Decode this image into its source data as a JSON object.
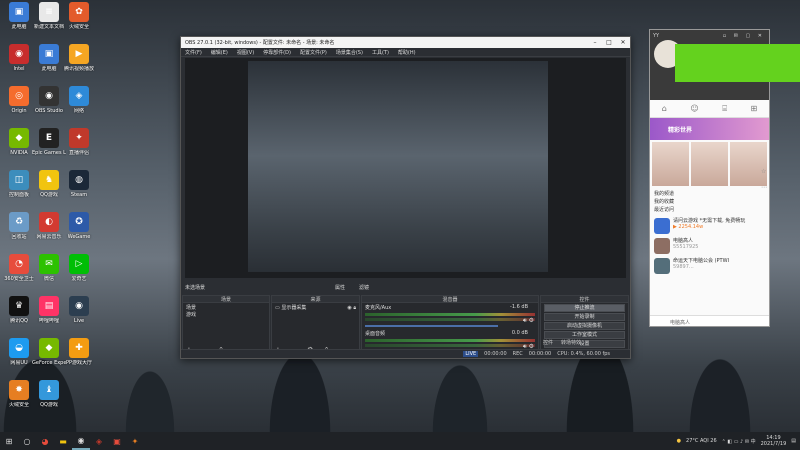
{
  "desktop": {
    "icons": [
      {
        "label": "此电脑",
        "glyph": "▣",
        "color": "#3a7bd5"
      },
      {
        "label": "新建文本文档",
        "glyph": "≡",
        "color": "#e8e8e8"
      },
      {
        "label": "火绒安全",
        "glyph": "✿",
        "color": "#e35b2b"
      },
      {
        "label": "Intel",
        "glyph": "◉",
        "color": "#c72d2d"
      },
      {
        "label": "此电脑",
        "glyph": "▣",
        "color": "#3a7bd5"
      },
      {
        "label": "腾讯视频播放",
        "glyph": "▶",
        "color": "#f5a623"
      },
      {
        "label": "Origin",
        "glyph": "◎",
        "color": "#f56c2d"
      },
      {
        "label": "OBS Studio",
        "glyph": "◉",
        "color": "#333"
      },
      {
        "label": "网络",
        "glyph": "◈",
        "color": "#2e8ad8"
      },
      {
        "label": "NVIDIA",
        "glyph": "◆",
        "color": "#76b900"
      },
      {
        "label": "Epic Games Launcher",
        "glyph": "E",
        "color": "#222"
      },
      {
        "label": "直播伴侣",
        "glyph": "✦",
        "color": "#c0392b"
      },
      {
        "label": "控制面板",
        "glyph": "◫",
        "color": "#3c8dbc"
      },
      {
        "label": "QQ游戏",
        "glyph": "♞",
        "color": "#f1c40f"
      },
      {
        "label": "Steam",
        "glyph": "◍",
        "color": "#1b2838"
      },
      {
        "label": "回收站",
        "glyph": "♻",
        "color": "#6b9bc7"
      },
      {
        "label": "网易云音乐",
        "glyph": "◐",
        "color": "#d33a31"
      },
      {
        "label": "WeGame",
        "glyph": "✪",
        "color": "#2d5aa8"
      },
      {
        "label": "360安全卫士",
        "glyph": "◔",
        "color": "#e74c3c"
      },
      {
        "label": "微信",
        "glyph": "✉",
        "color": "#2dc100"
      },
      {
        "label": "爱奇艺",
        "glyph": "▷",
        "color": "#00be06"
      },
      {
        "label": "腾讯QQ",
        "glyph": "♛",
        "color": "#111"
      },
      {
        "label": "哔哩哔哩",
        "glyph": "▤",
        "color": "#f36"
      },
      {
        "label": "Live",
        "glyph": "◉",
        "color": "#2c3e50"
      },
      {
        "label": "网易UU",
        "glyph": "◒",
        "color": "#1d9bf0"
      },
      {
        "label": "GeForce Experience",
        "glyph": "◆",
        "color": "#76b900"
      },
      {
        "label": "PP游戏大厅",
        "glyph": "✚",
        "color": "#f39c12"
      },
      {
        "label": "火绒安全",
        "glyph": "✸",
        "color": "#e67e22"
      },
      {
        "label": "QQ游戏",
        "glyph": "♝",
        "color": "#3498db"
      }
    ]
  },
  "obs": {
    "title": "OBS 27.0.1 (32-bit, windows) - 配置文件: 未命名 - 场景: 未命名",
    "menu": [
      "文件(F)",
      "编辑(E)",
      "视图(V)",
      "停靠部件(D)",
      "配置文件(P)",
      "场景集合(S)",
      "工具(T)",
      "帮助(H)"
    ],
    "scene_label": "未选场景",
    "tog_props": "属性",
    "tog_filters": "滤镜",
    "docks": {
      "scenes": {
        "title": "场景",
        "items": [
          "场景",
          "游戏"
        ]
      },
      "sources": {
        "title": "来源",
        "items": [
          "显示器采集"
        ]
      },
      "mixer": {
        "title": "混音器",
        "rows": [
          {
            "name": "麦克风/Aux",
            "db": "-1.6 dB",
            "level": 0.78
          },
          {
            "name": "桌面音频",
            "db": "0.0 dB",
            "level": 0.55
          }
        ]
      },
      "controls": {
        "title": "控件",
        "buttons": [
          "停止推流",
          "开始录制",
          "启动虚拟摄像机",
          "工作室模式",
          "设置",
          "退出"
        ]
      },
      "footer_tabs": [
        "控件",
        "转场特效"
      ]
    },
    "status": {
      "live": "LIVE",
      "live_time": "00:00:00",
      "rec": "REC",
      "rec_time": "00:00:00",
      "cpu": "CPU: 0.4%, 60.00 fps"
    }
  },
  "live_panel": {
    "banner": "精彩世界",
    "section_follow": "我的频道",
    "section_hot": "我的收藏",
    "section_recent": "最近访问",
    "feed": [
      {
        "title": "请问云游戏 *无需下载, 免费畅玩",
        "sub": "▶ 2254.14w"
      },
      {
        "title": "电脑高人",
        "meta": "55517925"
      },
      {
        "title": "命运天下电脑公会 (PTWI",
        "meta": "59897..."
      }
    ],
    "input_placeholder": "电脑高人"
  },
  "taskbar": {
    "weather": "27°C AQI 26",
    "time": "14:19",
    "date": "2021/7/19"
  }
}
